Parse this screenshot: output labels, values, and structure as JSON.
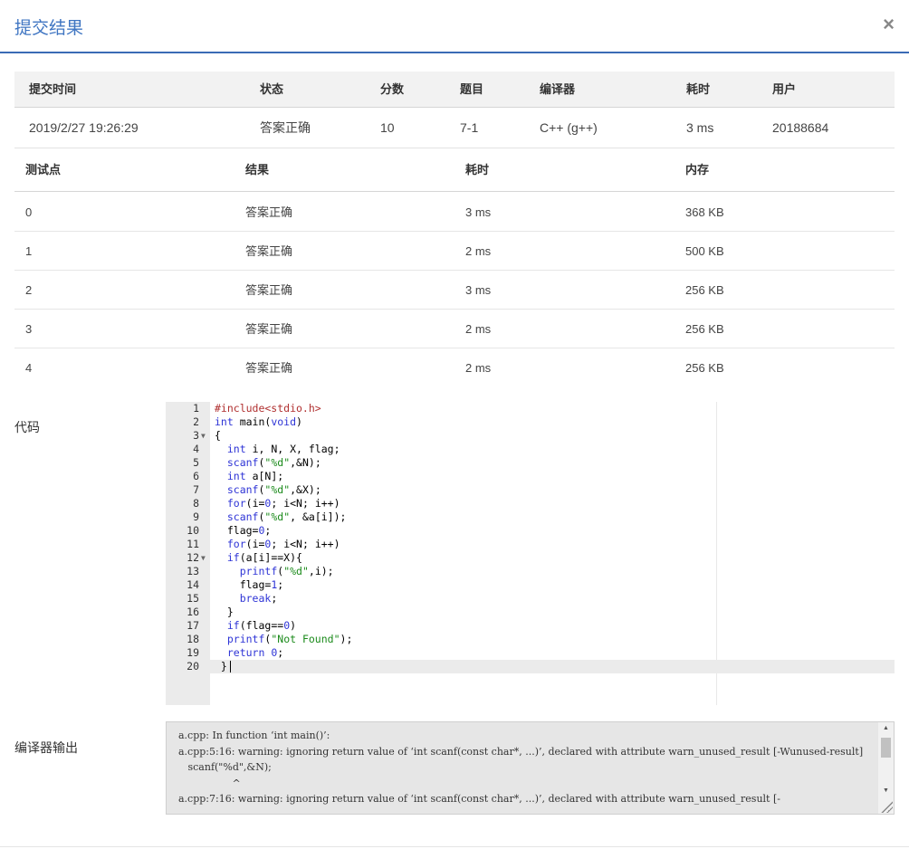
{
  "modal": {
    "title": "提交结果",
    "close": "×"
  },
  "summary": {
    "headers": {
      "time": "提交时间",
      "status": "状态",
      "score": "分数",
      "problem": "题目",
      "compiler": "编译器",
      "time_used": "耗时",
      "user": "用户"
    },
    "row": {
      "time": "2019/2/27 19:26:29",
      "status": "答案正确",
      "score": "10",
      "problem": "7-1",
      "compiler": "C++ (g++)",
      "time_used": "3 ms",
      "user": "20188684"
    }
  },
  "testcases": {
    "headers": {
      "case": "测试点",
      "result": "结果",
      "time": "耗时",
      "memory": "内存"
    },
    "rows": [
      {
        "case": "0",
        "result": "答案正确",
        "time": "3 ms",
        "memory": "368 KB"
      },
      {
        "case": "1",
        "result": "答案正确",
        "time": "2 ms",
        "memory": "500 KB"
      },
      {
        "case": "2",
        "result": "答案正确",
        "time": "3 ms",
        "memory": "256 KB"
      },
      {
        "case": "3",
        "result": "答案正确",
        "time": "2 ms",
        "memory": "256 KB"
      },
      {
        "case": "4",
        "result": "答案正确",
        "time": "2 ms",
        "memory": "256 KB"
      }
    ]
  },
  "code": {
    "label": "代码",
    "lines": [
      "#include<stdio.h>",
      "int main(void)",
      "{",
      "  int i, N, X, flag;",
      "  scanf(\"%d\",&N);",
      "  int a[N];",
      "  scanf(\"%d\",&X);",
      "  for(i=0; i<N; i++)",
      "  scanf(\"%d\", &a[i]);",
      "  flag=0;",
      "  for(i=0; i<N; i++)",
      "  if(a[i]==X){",
      "    printf(\"%d\",i);",
      "    flag=1;",
      "    break;",
      "  }",
      "  if(flag==0)",
      "  printf(\"Not Found\");",
      "  return 0;",
      " }"
    ],
    "active_line": 20,
    "fold_lines": [
      3,
      12
    ]
  },
  "compiler_output": {
    "label": "编译器输出",
    "text": "a.cpp: In function ‘int main()’:\na.cpp:5:16: warning: ignoring return value of ‘int scanf(const char*, ...)’, declared with attribute warn_unused_result [-Wunused-result]\n   scanf(\"%d\",&N);\n                 ^\na.cpp:7:16: warning: ignoring return value of ‘int scanf(const char*, ...)’, declared with attribute warn_unused_result [-"
  }
}
